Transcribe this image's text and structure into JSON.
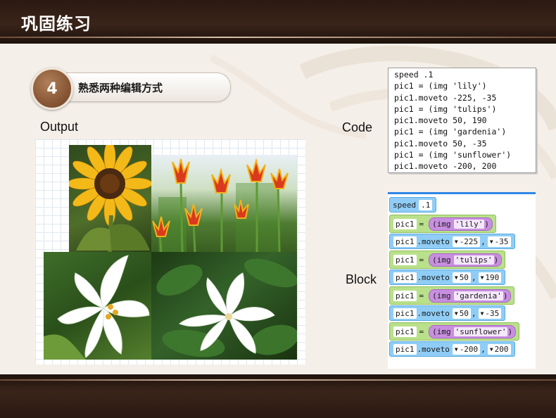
{
  "slide": {
    "title": "巩固练习",
    "step_number": "4",
    "step_label": "熟悉两种编辑方式"
  },
  "labels": {
    "output": "Output",
    "code": "Code",
    "block": "Block"
  },
  "code_lines": [
    "speed .1",
    "pic1 = (img 'lily')",
    "pic1.moveto -225, -35",
    "pic1 = (img 'tulips')",
    "pic1.moveto 50, 190",
    "pic1 = (img 'gardenia')",
    "pic1.moveto 50, -35",
    "pic1 = (img 'sunflower')",
    "pic1.moveto -200, 200"
  ],
  "blocks": {
    "speed_kw": "speed",
    "speed_val": ".1",
    "var": "pic1",
    "eq": "=",
    "img_kw": "img",
    "moveto": ".moveto",
    "comma": ",",
    "img1": "'lily'",
    "img2": "'tulips'",
    "img3": "'gardenia'",
    "img4": "'sunflower'",
    "m1x": "-225",
    "m1y": "-35",
    "m2x": "50",
    "m2y": "190",
    "m3x": "50",
    "m3y": "-35",
    "m4x": "-200",
    "m4y": "200"
  },
  "images": [
    "sunflower",
    "tulips",
    "lily",
    "gardenia"
  ],
  "colors": {
    "header_brown": "#2a1a12",
    "accent_circle": "#8c5a38",
    "block_blue": "#8fcdf6",
    "block_green": "#b9e08a",
    "block_purple": "#c88fdf",
    "editor_top_border": "#2f86e6"
  }
}
